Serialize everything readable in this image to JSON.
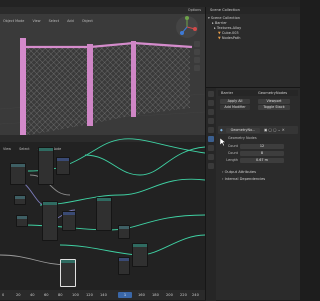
{
  "menubar": {
    "items": [
      "File",
      "Edit",
      "Render",
      "Window",
      "Help"
    ]
  },
  "viewport": {
    "header_items": [
      "Object Mode",
      "View",
      "Select",
      "Add",
      "Object"
    ],
    "options_label": "Options"
  },
  "node_editor": {
    "header_items": [
      "View",
      "Select",
      "Add",
      "Node"
    ]
  },
  "timeline": {
    "frames": [
      "0",
      "20",
      "40",
      "60",
      "80",
      "100",
      "120",
      "140",
      "160",
      "180",
      "200",
      "220",
      "240",
      "260"
    ],
    "current_frame": "1"
  },
  "outliner": {
    "title": "Scene Collection",
    "rows": [
      "Scene Collection",
      "Barrier",
      "Textures.Alloy",
      "Cube.003",
      "NodesPath"
    ]
  },
  "properties": {
    "object_name": "Barrier",
    "modifier_name": "GeometryNodes",
    "apply_label": "Apply All",
    "viewport_label": "Viewport",
    "toggle_stack": "Toggle Stack",
    "add_modifier": "Add Modifier",
    "gn_field_label": "GeometryNo...",
    "geometry_nodes_label": "Geometry Nodes",
    "params": [
      {
        "label": "Count",
        "value": "12"
      },
      {
        "label": "Count",
        "value": "8"
      },
      {
        "label": "Length",
        "value": "0.67 m"
      }
    ],
    "output_attributes": "Output Attributes",
    "internal_dependencies": "Internal Dependencies"
  }
}
